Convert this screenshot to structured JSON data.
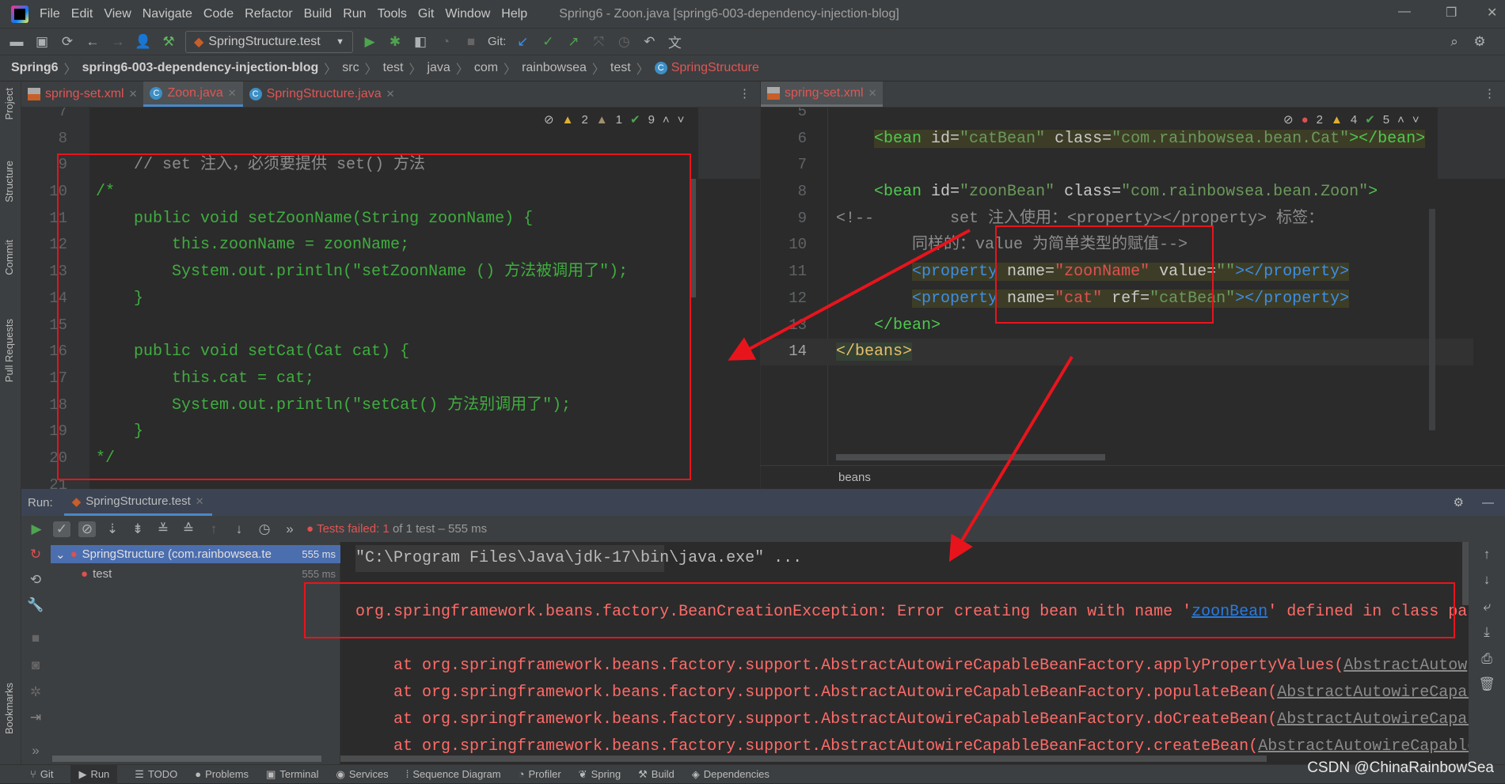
{
  "menubar": {
    "items": [
      "File",
      "Edit",
      "View",
      "Navigate",
      "Code",
      "Refactor",
      "Build",
      "Run",
      "Tools",
      "Git",
      "Window",
      "Help"
    ],
    "title": "Spring6 - Zoon.java [spring6-003-dependency-injection-blog]"
  },
  "toolbar": {
    "run_config": "SpringStructure.test",
    "git_label": "Git:"
  },
  "breadcrumb": [
    "Spring6",
    "spring6-003-dependency-injection-blog",
    "src",
    "test",
    "java",
    "com",
    "rainbowsea",
    "test",
    "SpringStructure"
  ],
  "left_strip": [
    "Project",
    "Structure",
    "Commit",
    "Pull Requests",
    "Bookmarks"
  ],
  "left_editor": {
    "tabs": [
      {
        "label": "spring-set.xml",
        "icon": "xml-file-icon"
      },
      {
        "label": "Zoon.java",
        "icon": "class-icon",
        "active": true
      },
      {
        "label": "SpringStructure.java",
        "icon": "test-class-icon"
      }
    ],
    "inspections": {
      "warnings": "2",
      "weak_warnings": "1",
      "ok": "9"
    },
    "lines": [
      {
        "n": "7",
        "t": "",
        "c": "g"
      },
      {
        "n": "8",
        "t": "",
        "c": "g"
      },
      {
        "n": "9",
        "t": "    // set 注入，必须要提供 set() 方法",
        "c": "cm"
      },
      {
        "n": "10",
        "t": "/*",
        "c": "g"
      },
      {
        "n": "11",
        "t": "    public void setZoonName(String zoonName) {",
        "c": "g"
      },
      {
        "n": "12",
        "t": "        this.zoonName = zoonName;",
        "c": "g"
      },
      {
        "n": "13",
        "t": "        System.out.println(\"setZoonName () 方法被调用了\");",
        "c": "g"
      },
      {
        "n": "14",
        "t": "    }",
        "c": "g"
      },
      {
        "n": "15",
        "t": "",
        "c": "g"
      },
      {
        "n": "16",
        "t": "    public void setCat(Cat cat) {",
        "c": "g"
      },
      {
        "n": "17",
        "t": "        this.cat = cat;",
        "c": "g"
      },
      {
        "n": "18",
        "t": "        System.out.println(\"setCat() 方法别调用了\");",
        "c": "g"
      },
      {
        "n": "19",
        "t": "    }",
        "c": "g"
      },
      {
        "n": "20",
        "t": "*/",
        "c": "g"
      },
      {
        "n": "21",
        "t": "",
        "c": "g"
      }
    ]
  },
  "right_editor": {
    "tabs": [
      {
        "label": "spring-set.xml",
        "icon": "xml-file-icon",
        "active": true
      }
    ],
    "inspections": {
      "errors": "2",
      "warnings": "4",
      "ok": "5"
    },
    "footer_breadcrumb": "beans",
    "lines": [
      {
        "n": "5",
        "tokens": []
      },
      {
        "n": "6",
        "tokens": [
          {
            "t": "    ",
            "c": "pl"
          },
          {
            "t": "<bean ",
            "c": "tag hl"
          },
          {
            "t": "id=",
            "c": "attr hl"
          },
          {
            "t": "\"catBean\"",
            "c": "val hl"
          },
          {
            "t": " class=",
            "c": "attr hl"
          },
          {
            "t": "\"com.rainbowsea.bean.Cat\"",
            "c": "val hl"
          },
          {
            "t": "></bean>",
            "c": "tag hl"
          }
        ]
      },
      {
        "n": "7",
        "tokens": []
      },
      {
        "n": "8",
        "tokens": [
          {
            "t": "    <bean ",
            "c": "tag"
          },
          {
            "t": "id=",
            "c": "attr"
          },
          {
            "t": "\"zoonBean\"",
            "c": "val"
          },
          {
            "t": " class=",
            "c": "attr"
          },
          {
            "t": "\"com.rainbowsea.bean.Zoon\"",
            "c": "val"
          },
          {
            "t": ">",
            "c": "tag"
          }
        ]
      },
      {
        "n": "9",
        "tokens": [
          {
            "t": "<!--        set 注入使用：<property></property> 标签：",
            "c": "cm"
          }
        ]
      },
      {
        "n": "10",
        "tokens": [
          {
            "t": "        同样的：value 为简单类型的赋值-->",
            "c": "cm"
          }
        ]
      },
      {
        "n": "11",
        "tokens": [
          {
            "t": "        ",
            "c": "pl"
          },
          {
            "t": "<property ",
            "c": "ptag hl"
          },
          {
            "t": "name=",
            "c": "attr hl"
          },
          {
            "t": "\"zoonName\"",
            "c": "red hl"
          },
          {
            "t": " value=",
            "c": "attr hl"
          },
          {
            "t": "\"\"",
            "c": "val hl"
          },
          {
            "t": "></property>",
            "c": "ptag hl"
          }
        ]
      },
      {
        "n": "12",
        "tokens": [
          {
            "t": "        ",
            "c": "pl"
          },
          {
            "t": "<property ",
            "c": "ptag hl"
          },
          {
            "t": "name=",
            "c": "attr hl"
          },
          {
            "t": "\"cat\"",
            "c": "red hl"
          },
          {
            "t": " ref=",
            "c": "attr hl"
          },
          {
            "t": "\"catBean\"",
            "c": "val hl"
          },
          {
            "t": "></property>",
            "c": "ptag hl"
          }
        ]
      },
      {
        "n": "13",
        "tokens": [
          {
            "t": "    </bean>",
            "c": "tag"
          }
        ]
      },
      {
        "n": "14",
        "tokens": [
          {
            "t": "</beans>",
            "c": "yel"
          }
        ],
        "current": true
      }
    ]
  },
  "run": {
    "label": "Run:",
    "tab": "SpringStructure.test",
    "status_prefix": "Tests failed: 1",
    "status_suffix": " of 1 test – 555 ms",
    "tree": [
      {
        "label": "SpringStructure (com.rainbowsea.te",
        "time": "555 ms",
        "selected": true
      },
      {
        "label": "test",
        "time": "555 ms"
      }
    ],
    "console": {
      "command": "\"C:\\Program Files\\Java\\jdk-17\\bin\\java.exe\" ...",
      "exception_prefix": "org.springframework.beans.factory.BeanCreationException: Error creating bean with name '",
      "exception_link": "zoonBean",
      "exception_suffix": "' defined in class pat",
      "stack": [
        {
          "t": "    at org.springframework.beans.factory.support.AbstractAutowireCapableBeanFactory.applyPropertyValues(",
          "l": "AbstractAutow"
        },
        {
          "t": "    at org.springframework.beans.factory.support.AbstractAutowireCapableBeanFactory.populateBean(",
          "l": "AbstractAutowireCapab"
        },
        {
          "t": "    at org.springframework.beans.factory.support.AbstractAutowireCapableBeanFactory.doCreateBean(",
          "l": "AbstractAutowireCapab"
        },
        {
          "t": "    at org.springframework.beans.factory.support.AbstractAutowireCapableBeanFactory.createBean(",
          "l": "AbstractAutowireCapable"
        }
      ]
    }
  },
  "statusbar": [
    {
      "label": "Git",
      "icon": "git-icon"
    },
    {
      "label": "Run",
      "icon": "run-icon",
      "active": true
    },
    {
      "label": "TODO",
      "icon": "todo-icon"
    },
    {
      "label": "Problems",
      "icon": "problems-icon"
    },
    {
      "label": "Terminal",
      "icon": "terminal-icon"
    },
    {
      "label": "Services",
      "icon": "services-icon"
    },
    {
      "label": "Sequence Diagram",
      "icon": "sequence-diagram-icon"
    },
    {
      "label": "Profiler",
      "icon": "profiler-icon"
    },
    {
      "label": "Spring",
      "icon": "spring-icon"
    },
    {
      "label": "Build",
      "icon": "build-icon"
    },
    {
      "label": "Dependencies",
      "icon": "dependencies-icon"
    }
  ],
  "watermark": "CSDN @ChinaRainbowSea",
  "colors": {
    "annotation_red": "#e8141c",
    "error_text": "#ff6b68",
    "link": "#287bde",
    "selection": "#4b6eaf"
  }
}
